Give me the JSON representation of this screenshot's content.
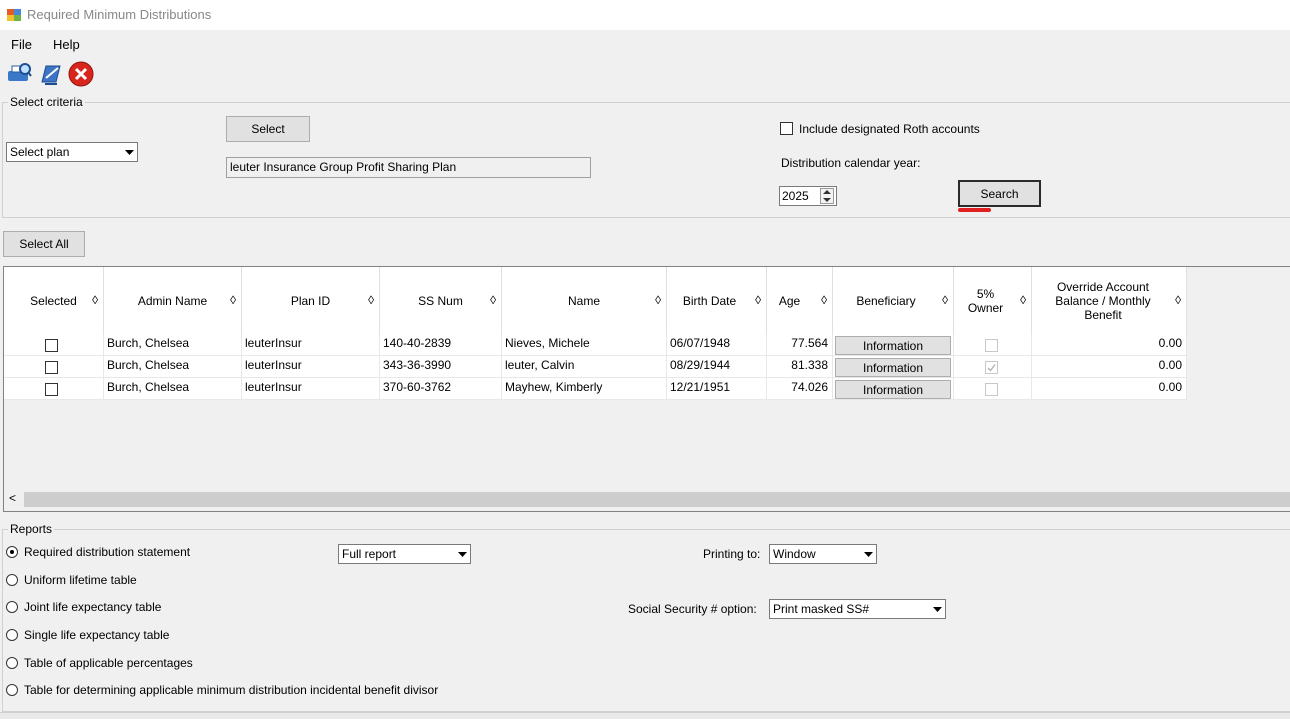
{
  "window": {
    "title": "Required Minimum Distributions"
  },
  "menu": {
    "file": "File",
    "help": "Help"
  },
  "toolbar": {
    "icons": [
      "print-preview-icon",
      "edit-book-icon",
      "close-icon"
    ]
  },
  "criteria": {
    "legend": "Select criteria",
    "plan_combo": "Select plan",
    "select_button": "Select",
    "plan_name": "leuter Insurance Group Profit Sharing Plan",
    "roth_label": "Include designated Roth accounts",
    "year_label": "Distribution calendar year:",
    "year_value": "2025",
    "search_button": "Search"
  },
  "select_all": "Select All",
  "grid": {
    "columns": [
      "Selected",
      "Admin Name",
      "Plan ID",
      "SS Num",
      "Name",
      "Birth Date",
      "Age",
      "Beneficiary",
      "5% Owner",
      "Override Account Balance / Monthly Benefit"
    ],
    "sort_glyph": "◊",
    "rows": [
      {
        "admin": "Burch, Chelsea",
        "plan": "leuterInsur",
        "ss": "140-40-2839",
        "name": "Nieves, Michele",
        "birth": "06/07/1948",
        "age": "77.564",
        "beneficiary": "Information",
        "owner": false,
        "override": "0.00"
      },
      {
        "admin": "Burch, Chelsea",
        "plan": "leuterInsur",
        "ss": "343-36-3990",
        "name": "leuter, Calvin",
        "birth": "08/29/1944",
        "age": "81.338",
        "beneficiary": "Information",
        "owner": true,
        "override": "0.00"
      },
      {
        "admin": "Burch, Chelsea",
        "plan": "leuterInsur",
        "ss": "370-60-3762",
        "name": "Mayhew, Kimberly",
        "birth": "12/21/1951",
        "age": "74.026",
        "beneficiary": "Information",
        "owner": false,
        "override": "0.00"
      }
    ],
    "scroll_left": "<"
  },
  "reports": {
    "legend": "Reports",
    "options": [
      "Required distribution statement",
      "Uniform lifetime table",
      "Joint life expectancy table",
      "Single life expectancy table",
      "Table of applicable percentages",
      "Table for determining applicable minimum distribution incidental benefit divisor"
    ],
    "selected_index": 0,
    "report_type": "Full report",
    "printing_label": "Printing to:",
    "printing_value": "Window",
    "ss_label": "Social Security # option:",
    "ss_value": "Print masked SS#"
  }
}
